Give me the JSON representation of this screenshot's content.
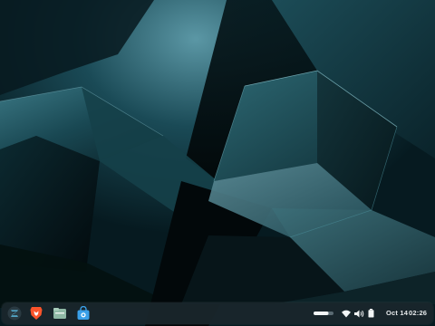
{
  "desktop": {
    "wallpaper": "abstract-cubes-teal"
  },
  "taskbar": {
    "launcher_icon": "zorin-logo-icon",
    "pinned_apps": [
      {
        "name": "brave-browser",
        "icon": "brave-lion-icon",
        "color": "#fb542b"
      },
      {
        "name": "files",
        "icon": "folder-icon",
        "color": "#8fb9a6"
      },
      {
        "name": "software-store",
        "icon": "store-bag-icon",
        "color": "#3aa0e8"
      }
    ],
    "tray": {
      "brightness_level": 0.75,
      "icons": [
        "wifi-icon",
        "volume-icon",
        "battery-icon"
      ]
    },
    "clock": {
      "date": "Oct 14",
      "time": "02:26"
    }
  }
}
